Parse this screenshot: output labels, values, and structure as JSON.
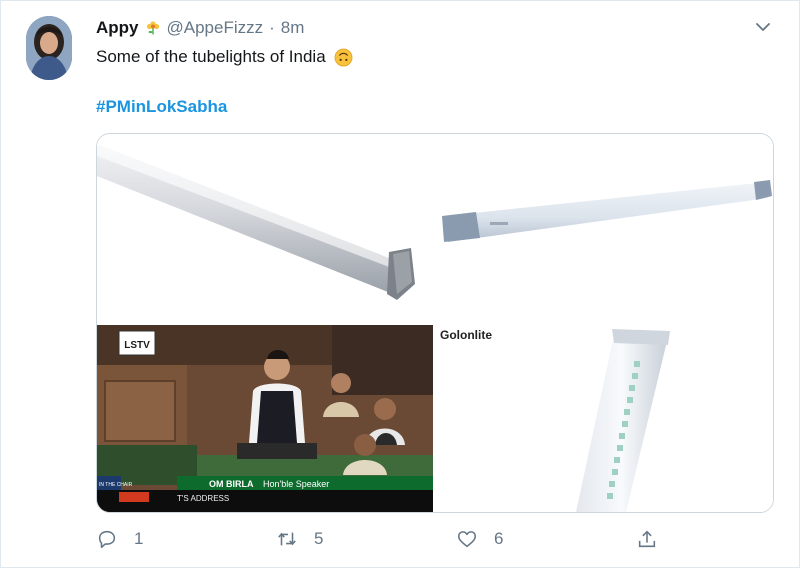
{
  "tweet": {
    "author_name": "Appy",
    "handle": "@AppeFizzz",
    "separator": "·",
    "time": "8m",
    "text": "Some of the tubelights of India",
    "hashtag": "#PMinLokSabha"
  },
  "media": {
    "images": [
      {
        "label": "tubelight-photo-1"
      },
      {
        "label": "tubelight-photo-2"
      },
      {
        "label": "lok-sabha-tv-frame",
        "channel_logo": "LSTV",
        "ticker_name": "OM BIRLA",
        "ticker_title": "Hon'ble Speaker",
        "bottom_left": "IN THE CHAIR",
        "bottom_text": "T'S ADDRESS"
      },
      {
        "label": "tubelight-photo-3",
        "brand": "Golonlite"
      }
    ]
  },
  "actions": {
    "reply_count": "1",
    "retweet_count": "5",
    "like_count": "6"
  },
  "colors": {
    "link": "#1b95e0",
    "muted": "#657786",
    "border": "#e1e8ed"
  },
  "icons": [
    "chevron-down-icon",
    "reply-icon",
    "retweet-icon",
    "like-icon",
    "share-icon",
    "flower-badge-icon",
    "upside-down-face-emoji"
  ]
}
